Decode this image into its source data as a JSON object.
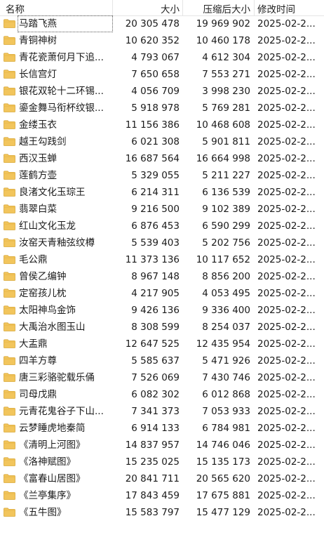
{
  "header": {
    "name": "名称",
    "size": "大小",
    "compressed_size": "压缩后大小",
    "modified": "修改时间"
  },
  "folder_color": "#f2c55c",
  "rows": [
    {
      "name": "马踏飞燕",
      "size": "20 305 478",
      "csize": "19 969 902",
      "date": "2025-02-2..."
    },
    {
      "name": "青铜神树",
      "size": "10 620 352",
      "csize": "10 460 178",
      "date": "2025-02-2..."
    },
    {
      "name": "青花瓷萧何月下追...",
      "size": "4 793 067",
      "csize": "4 612 304",
      "date": "2025-02-2..."
    },
    {
      "name": "长信宫灯",
      "size": "7 650 658",
      "csize": "7 553 271",
      "date": "2025-02-2..."
    },
    {
      "name": "银花双轮十二环锡...",
      "size": "4 056 709",
      "csize": "3 998 230",
      "date": "2025-02-2..."
    },
    {
      "name": "鎏金舞马衔杯纹银...",
      "size": "5 918 978",
      "csize": "5 769 281",
      "date": "2025-02-2..."
    },
    {
      "name": "金缕玉衣",
      "size": "11 156 386",
      "csize": "10 468 608",
      "date": "2025-02-2..."
    },
    {
      "name": "越王勾践剑",
      "size": "6 021 308",
      "csize": "5 901 811",
      "date": "2025-02-2..."
    },
    {
      "name": "西汉玉蝉",
      "size": "16 687 564",
      "csize": "16 664 998",
      "date": "2025-02-2..."
    },
    {
      "name": "莲鹤方壶",
      "size": "5 329 055",
      "csize": "5 211 227",
      "date": "2025-02-2..."
    },
    {
      "name": "良渚文化玉琮王",
      "size": "6 214 311",
      "csize": "6 136 539",
      "date": "2025-02-2..."
    },
    {
      "name": "翡翠白菜",
      "size": "9 216 500",
      "csize": "9 102 389",
      "date": "2025-02-2..."
    },
    {
      "name": "红山文化玉龙",
      "size": "6 876 453",
      "csize": "6 590 299",
      "date": "2025-02-2..."
    },
    {
      "name": "汝窑天青釉弦纹樽",
      "size": "5 539 403",
      "csize": "5 202 756",
      "date": "2025-02-2..."
    },
    {
      "name": "毛公鼎",
      "size": "11 373 136",
      "csize": "10 117 652",
      "date": "2025-02-2..."
    },
    {
      "name": "曾侯乙编钟",
      "size": "8 967 148",
      "csize": "8 856 200",
      "date": "2025-02-2..."
    },
    {
      "name": "定窑孩儿枕",
      "size": "4 217 905",
      "csize": "4 053 495",
      "date": "2025-02-2..."
    },
    {
      "name": "太阳神鸟金饰",
      "size": "9 426 136",
      "csize": "9 336 400",
      "date": "2025-02-2..."
    },
    {
      "name": "大禹治水图玉山",
      "size": "8 308 599",
      "csize": "8 254 037",
      "date": "2025-02-2..."
    },
    {
      "name": "大盂鼎",
      "size": "12 647 525",
      "csize": "12 435 954",
      "date": "2025-02-2..."
    },
    {
      "name": "四羊方尊",
      "size": "5 585 637",
      "csize": "5 471 926",
      "date": "2025-02-2..."
    },
    {
      "name": "唐三彩骆驼载乐俑",
      "size": "7 526 069",
      "csize": "7 430 746",
      "date": "2025-02-2..."
    },
    {
      "name": "司母戊鼎",
      "size": "6 082 302",
      "csize": "6 012 868",
      "date": "2025-02-2..."
    },
    {
      "name": "元青花鬼谷子下山...",
      "size": "7 341 373",
      "csize": "7 053 933",
      "date": "2025-02-2..."
    },
    {
      "name": "云梦睡虎地秦简",
      "size": "6 914 133",
      "csize": "6 784 981",
      "date": "2025-02-2..."
    },
    {
      "name": "《清明上河图》",
      "size": "14 837 957",
      "csize": "14 746 046",
      "date": "2025-02-2..."
    },
    {
      "name": "《洛神赋图》",
      "size": "15 235 025",
      "csize": "15 135 173",
      "date": "2025-02-2..."
    },
    {
      "name": "《富春山居图》",
      "size": "20 841 711",
      "csize": "20 565 620",
      "date": "2025-02-2..."
    },
    {
      "name": "《兰亭集序》",
      "size": "17 843 459",
      "csize": "17 675 881",
      "date": "2025-02-2..."
    },
    {
      "name": "《五牛图》",
      "size": "15 583 797",
      "csize": "15 477 129",
      "date": "2025-02-2..."
    }
  ]
}
